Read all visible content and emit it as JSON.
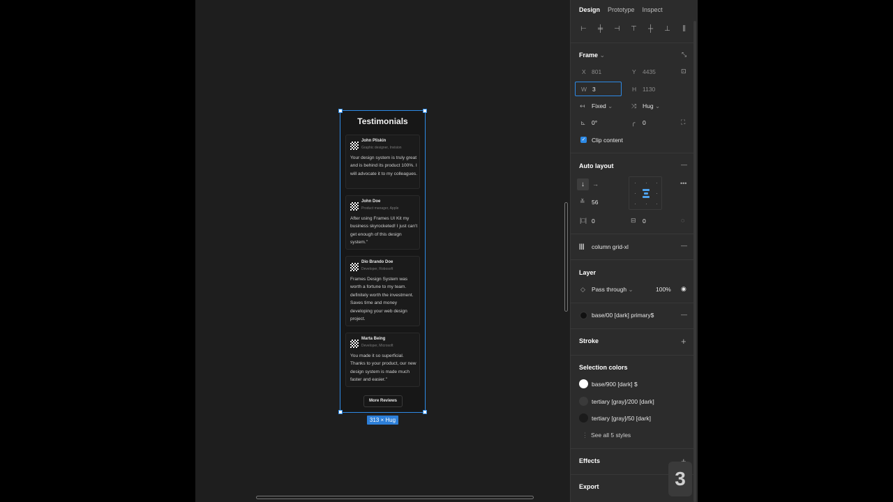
{
  "frame": {
    "title": "Testimonials",
    "cards": [
      {
        "name": "John Pliskin",
        "role": "Graphic designer, Invision",
        "quote": "Your design system is truly great and is behind its product 100%. I will advocate it to my colleagues."
      },
      {
        "name": "John Doe",
        "role": "Product manager, Apple",
        "quote": "After using Frames UI Kit my business skyrocketed! I just can't get enough of this design system.\""
      },
      {
        "name": "Dio Brando Doe",
        "role": "Developer, Robosoft",
        "quote": "Frames Design System was worth a fortune to my team. definitely worth the investment. Saves time and money developing your web design project."
      },
      {
        "name": "Marta Being",
        "role": "Developer, Microsoft",
        "quote": "You made it so superficial. Thanks to your product, our new design system is made much faster and easier.\""
      }
    ],
    "more_button": "More Reviews",
    "size_badge": "313 × Hug"
  },
  "panel": {
    "tabs": [
      "Design",
      "Prototype",
      "Inspect"
    ],
    "frame_section": {
      "title": "Frame",
      "x_label": "X",
      "x_value": "801",
      "y_label": "Y",
      "y_value": "4435",
      "w_label": "W",
      "w_value": "3",
      "h_label": "H",
      "h_value": "1130",
      "width_mode": "Fixed",
      "height_mode": "Hug",
      "rotation": "0°",
      "radius": "0",
      "clip_content": "Clip content"
    },
    "auto_layout": {
      "title": "Auto layout",
      "spacing": "56",
      "padding_h": "0",
      "padding_v": "0"
    },
    "grid": {
      "name": "column grid-xl"
    },
    "layer": {
      "title": "Layer",
      "blend": "Pass through",
      "opacity": "100%"
    },
    "fill": {
      "name": "base/00 [dark] primary$",
      "color": "#1a1a1a"
    },
    "stroke": {
      "title": "Stroke"
    },
    "selection_colors": {
      "title": "Selection colors",
      "items": [
        {
          "name": "base/900 [dark] $",
          "color": "#ffffff"
        },
        {
          "name": "tertiary [gray]/200 [dark]",
          "color": "#3a3a3a"
        },
        {
          "name": "tertiary [gray]/50 [dark]",
          "color": "#1e1e1e"
        }
      ],
      "see_all": "See all 5 styles"
    },
    "effects": {
      "title": "Effects"
    },
    "export": {
      "title": "Export"
    }
  },
  "overlay_badge": "3"
}
